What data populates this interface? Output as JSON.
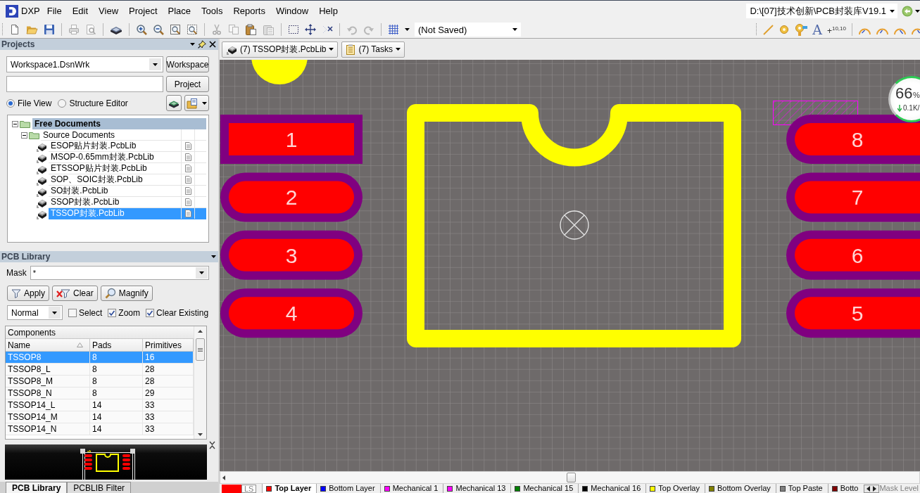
{
  "menu_bar": {
    "logo": "DXP",
    "items": [
      "File",
      "Edit",
      "View",
      "Project",
      "Place",
      "Tools",
      "Reports",
      "Window",
      "Help"
    ],
    "path": "D:\\[07]技术创新\\PCB封装库V19.1"
  },
  "toolbar": {
    "document_combo": "(Not Saved)",
    "string_tool": "A",
    "coordinate_tool": "+$^{10,10}$"
  },
  "projects_panel": {
    "title": "Projects",
    "workspace": "Workspace1.DsnWrk",
    "workspace_button": "Workspace",
    "project_button": "Project",
    "views": [
      {
        "label": "File View",
        "selected": true
      },
      {
        "label": "Structure Editor",
        "selected": false
      }
    ],
    "tree": [
      {
        "kind": "project",
        "label": "Free Documents",
        "expanded": true,
        "selected": false,
        "children": [
          {
            "kind": "folder",
            "label": "Source Documents",
            "expanded": true,
            "selected": false,
            "children": [
              {
                "kind": "file",
                "label": "ESOP贴片封装.PcbLib",
                "selected": false
              },
              {
                "kind": "file",
                "label": "MSOP-0.65mm封装.PcbLib",
                "selected": false
              },
              {
                "kind": "file",
                "label": "ETSSOP贴片封装.PcbLib",
                "selected": false
              },
              {
                "kind": "file",
                "label": "SOP、SOIC封装.PcbLib",
                "selected": false
              },
              {
                "kind": "file",
                "label": "SO封装.PcbLib",
                "selected": false
              },
              {
                "kind": "file",
                "label": "SSOP封装.PcbLib",
                "selected": false
              },
              {
                "kind": "file",
                "label": "TSSOP封装.PcbLib",
                "selected": true
              }
            ]
          }
        ]
      }
    ]
  },
  "pcb_library_panel": {
    "title": "PCB Library",
    "mask_label": "Mask",
    "mask": "*",
    "buttons": [
      "Apply",
      "Clear",
      "Magnify"
    ],
    "mode": "Normal",
    "options": [
      {
        "label": "Select",
        "checked": false
      },
      {
        "label": "Zoom",
        "checked": true
      },
      {
        "label": "Clear Existing",
        "checked": true
      }
    ],
    "components": {
      "title": "Components",
      "columns": [
        "Name",
        "Pads",
        "Primitives"
      ],
      "rows": [
        {
          "cells": [
            "TSSOP8",
            "8",
            "16"
          ],
          "selected": true
        },
        {
          "cells": [
            "TSSOP8_L",
            "8",
            "28"
          ],
          "selected": false
        },
        {
          "cells": [
            "TSSOP8_M",
            "8",
            "28"
          ],
          "selected": false
        },
        {
          "cells": [
            "TSSOP8_N",
            "8",
            "29"
          ],
          "selected": false
        },
        {
          "cells": [
            "TSSOP14_L",
            "14",
            "33"
          ],
          "selected": false
        },
        {
          "cells": [
            "TSSOP14_M",
            "14",
            "33"
          ],
          "selected": false
        },
        {
          "cells": [
            "TSSOP14_N",
            "14",
            "33"
          ],
          "selected": false
        }
      ]
    }
  },
  "panel_tabs": [
    {
      "label": "PCB Library",
      "selected": true
    },
    {
      "label": "PCBLIB Filter",
      "selected": false
    }
  ],
  "document_tabs": [
    "(7) TSSOP封装.PcbLib",
    "(7) Tasks"
  ],
  "canvas": {
    "pads": [
      {
        "number": "1",
        "kind": "rectangular"
      },
      {
        "number": "8",
        "kind": "rounded"
      },
      {
        "number": "2",
        "kind": "rounded"
      },
      {
        "number": "7",
        "kind": "rounded"
      },
      {
        "number": "3",
        "kind": "rounded"
      },
      {
        "number": "6",
        "kind": "rounded"
      },
      {
        "number": "4",
        "kind": "rounded"
      },
      {
        "number": "5",
        "kind": "rounded"
      }
    ]
  },
  "speed_meter": {
    "percent": "66",
    "unit": "%",
    "rate": "0.1K/"
  },
  "layer_bar": {
    "layer_set": "LS",
    "layers": [
      {
        "label": "Top Layer",
        "color": "#ff0000",
        "selected": true
      },
      {
        "label": "Bottom Layer",
        "color": "#0000ff",
        "selected": false
      },
      {
        "label": "Mechanical 1",
        "color": "#ff00ff",
        "selected": false
      },
      {
        "label": "Mechanical 13",
        "color": "#ff00ff",
        "selected": false
      },
      {
        "label": "Mechanical 15",
        "color": "#008000",
        "selected": false
      },
      {
        "label": "Mechanical 16",
        "color": "#000000",
        "selected": false
      },
      {
        "label": "Top Overlay",
        "color": "#ffff00",
        "selected": false
      },
      {
        "label": "Bottom Overlay",
        "color": "#808000",
        "selected": false
      },
      {
        "label": "Top Paste",
        "color": "#808080",
        "selected": false
      },
      {
        "label": "Botto",
        "color": "#800000",
        "selected": false
      }
    ],
    "mask_level": "Mask Level"
  }
}
